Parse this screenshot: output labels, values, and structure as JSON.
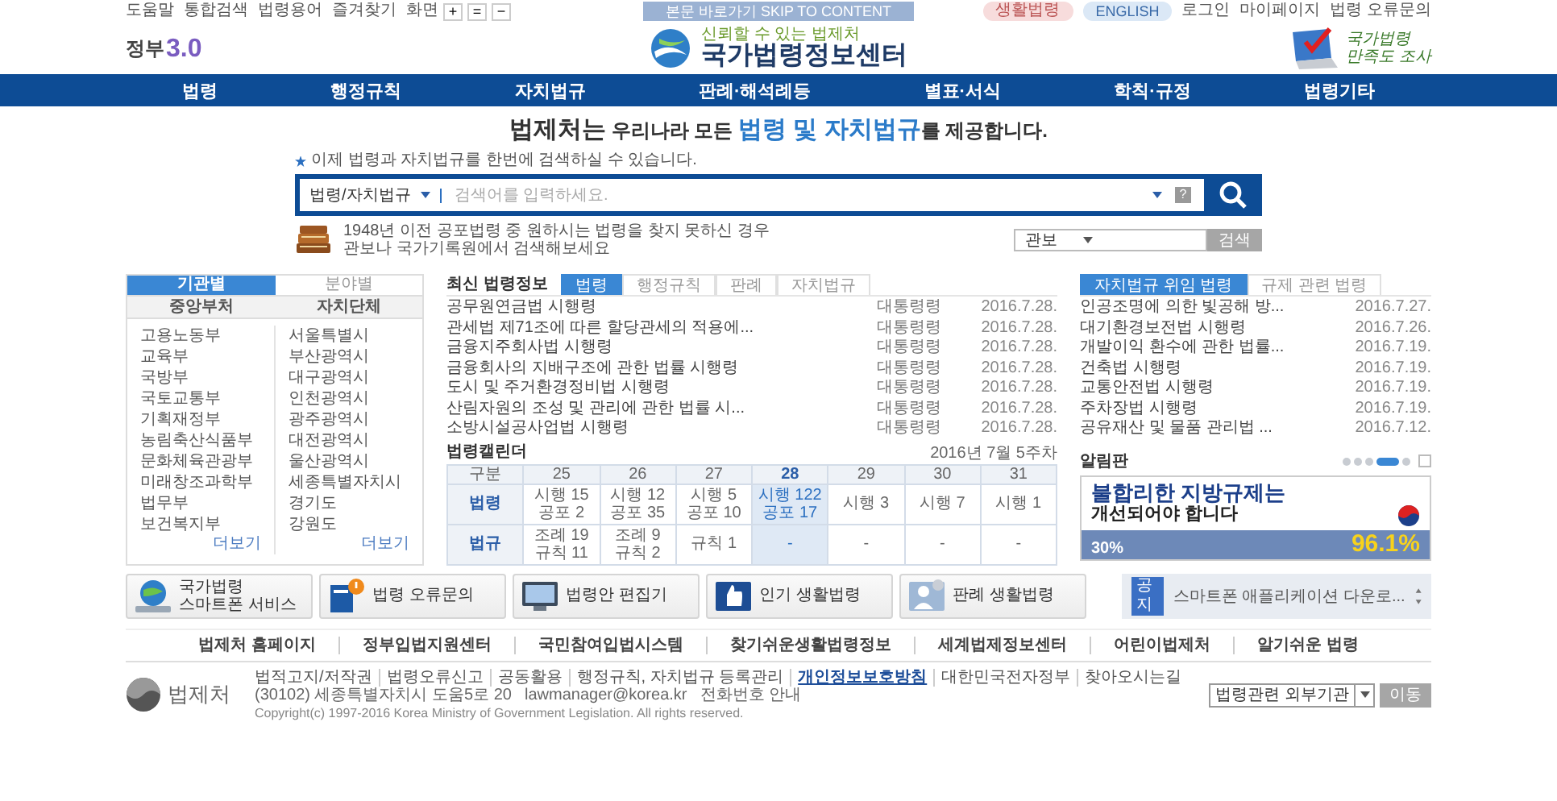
{
  "top_bar": {
    "links": [
      "도움말",
      "통합검색",
      "법령용어",
      "즐겨찾기"
    ],
    "zoom_label": "화면",
    "zoom_buttons": [
      "+",
      "=",
      "−"
    ],
    "skip_link": "본문 바로가기 SKIP TO CONTENT",
    "right_links": [
      {
        "label": "생활법령",
        "kind": "pink"
      },
      {
        "label": "ENGLISH",
        "kind": "blue"
      },
      {
        "label": "로그인",
        "kind": "plain"
      },
      {
        "label": "마이페이지",
        "kind": "plain"
      },
      {
        "label": "법령 오류문의",
        "kind": "plain"
      }
    ]
  },
  "header": {
    "gov_text": "정부",
    "gov_version": "3.0",
    "tagline": "신뢰할 수 있는 법제처",
    "title": "국가법령정보센터",
    "survey_lines": [
      "국가법령",
      "만족도 조사"
    ]
  },
  "nav": [
    "법령",
    "행정규칙",
    "자치법규",
    "판례·해석례등",
    "별표·서식",
    "학칙·규정",
    "법령기타"
  ],
  "headline": [
    {
      "text": "법제처는",
      "kind": "lead"
    },
    {
      "text": " 우리나라 모든 ",
      "kind": "plain"
    },
    {
      "text": "법령 및 자치법규",
      "kind": "key"
    },
    {
      "text": "를 제공합니다.",
      "kind": "plain"
    }
  ],
  "search": {
    "note": "이제 법령과 자치법규를 한번에 검색하실 수 있습니다.",
    "scope": "법령/자치법규",
    "placeholder": "검색어를 입력하세요.",
    "help": "?"
  },
  "archive": {
    "lines": [
      "1948년 이전 공포법령 중 원하시는 법령을 찾지 못하신 경우",
      "관보나 국가기록원에서 검색해보세요"
    ],
    "select": "관보",
    "button": "검색"
  },
  "org_panel": {
    "tabs": [
      {
        "label": "기관별",
        "selected": true
      },
      {
        "label": "분야별",
        "selected": false
      }
    ],
    "columns": [
      {
        "heading": "중앙부처",
        "items": [
          "고용노동부",
          "교육부",
          "국방부",
          "국토교통부",
          "기획재정부",
          "농림축산식품부",
          "문화체육관광부",
          "미래창조과학부",
          "법무부",
          "보건복지부"
        ],
        "more": "더보기"
      },
      {
        "heading": "자치단체",
        "items": [
          "서울특별시",
          "부산광역시",
          "대구광역시",
          "인천광역시",
          "광주광역시",
          "대전광역시",
          "울산광역시",
          "세종특별자치시",
          "경기도",
          "강원도"
        ],
        "more": "더보기"
      }
    ]
  },
  "latest": {
    "title": "최신 법령정보",
    "tabs": [
      {
        "label": "법령",
        "selected": true
      },
      {
        "label": "행정규칙",
        "selected": false
      },
      {
        "label": "판례",
        "selected": false
      },
      {
        "label": "자치법규",
        "selected": false
      }
    ],
    "rows": [
      {
        "title": "공무원연금법 시행령",
        "type": "대통령령",
        "date": "2016.7.28."
      },
      {
        "title": "관세법 제71조에 따른 할당관세의 적용에...",
        "type": "대통령령",
        "date": "2016.7.28."
      },
      {
        "title": "금융지주회사법 시행령",
        "type": "대통령령",
        "date": "2016.7.28."
      },
      {
        "title": "금융회사의 지배구조에 관한 법률 시행령",
        "type": "대통령령",
        "date": "2016.7.28."
      },
      {
        "title": "도시 및 주거환경정비법 시행령",
        "type": "대통령령",
        "date": "2016.7.28."
      },
      {
        "title": "산림자원의 조성 및 관리에 관한 법률 시...",
        "type": "대통령령",
        "date": "2016.7.28."
      },
      {
        "title": "소방시설공사업법 시행령",
        "type": "대통령령",
        "date": "2016.7.28."
      }
    ]
  },
  "calendar": {
    "title": "법령캘린더",
    "week": "2016년 7월 5주차",
    "corner": "구분",
    "columns": [
      {
        "label": "25",
        "selected": false
      },
      {
        "label": "26",
        "selected": false
      },
      {
        "label": "27",
        "selected": false
      },
      {
        "label": "28",
        "selected": true
      },
      {
        "label": "29",
        "selected": false
      },
      {
        "label": "30",
        "selected": false
      },
      {
        "label": "31",
        "selected": false
      }
    ],
    "rows": [
      {
        "label": "법령",
        "cells": [
          [
            "시행 15",
            "공포 2"
          ],
          [
            "시행 12",
            "공포 35"
          ],
          [
            "시행 5",
            "공포 10"
          ],
          [
            "시행 122",
            "공포 17"
          ],
          [
            "시행 3"
          ],
          [
            "시행 7"
          ],
          [
            "시행 1"
          ]
        ]
      },
      {
        "label": "법규",
        "cells": [
          [
            "조례 19",
            "규칙 11"
          ],
          [
            "조례 9",
            "규칙 2"
          ],
          [
            "규칙 1"
          ],
          [
            "-"
          ],
          [
            "-"
          ],
          [
            "-"
          ],
          [
            "-"
          ]
        ]
      }
    ]
  },
  "delegated": {
    "tabs": [
      {
        "label": "자치법규 위임 법령",
        "selected": true
      },
      {
        "label": "규제 관련 법령",
        "selected": false
      }
    ],
    "rows": [
      {
        "title": "인공조명에 의한 빛공해 방...",
        "date": "2016.7.27."
      },
      {
        "title": "대기환경보전법 시행령",
        "date": "2016.7.26."
      },
      {
        "title": "개발이익 환수에 관한 법률...",
        "date": "2016.7.19."
      },
      {
        "title": "건축법 시행령",
        "date": "2016.7.19."
      },
      {
        "title": "교통안전법 시행령",
        "date": "2016.7.19."
      },
      {
        "title": "주차장법 시행령",
        "date": "2016.7.19."
      },
      {
        "title": "공유재산 및 물품 관리법 ...",
        "date": "2016.7.12."
      }
    ]
  },
  "notice_board": {
    "title": "알림판",
    "pages": [
      {
        "selected": false
      },
      {
        "selected": false
      },
      {
        "selected": false
      },
      {
        "selected": true
      },
      {
        "selected": false
      }
    ],
    "banner": {
      "headline": "불합리한 지방규제는",
      "subline": "개선되어야 합니다",
      "small": "30%",
      "big": "96.1%"
    }
  },
  "quick_buttons": [
    {
      "label": "국가법령\n스마트폰 서비스",
      "kind": "globe"
    },
    {
      "label": "법령 오류문의",
      "kind": "alert"
    },
    {
      "label": "법령안 편집기",
      "kind": "monitor"
    },
    {
      "label": "인기 생활법령",
      "kind": "thumb"
    },
    {
      "label": "판례 생활법령",
      "kind": "person"
    }
  ],
  "notice": {
    "badge": "공지",
    "text": "스마트폰 애플리케이션 다운로..."
  },
  "related_sites": [
    "법제처 홈페이지",
    "정부입법지원센터",
    "국민참여입법시스템",
    "찾기쉬운생활법령정보",
    "세계법제정보센터",
    "어린이법제처",
    "알기쉬운 법령"
  ],
  "footer": {
    "logo": "법제처",
    "links": [
      {
        "label": "법적고지/저작권",
        "emphasis": false
      },
      {
        "label": "법령오류신고",
        "emphasis": false
      },
      {
        "label": "공동활용",
        "emphasis": false
      },
      {
        "label": "행정규칙, 자치법규 등록관리",
        "emphasis": false
      },
      {
        "label": "개인정보보호방침",
        "emphasis": true
      },
      {
        "label": "대한민국전자정부",
        "emphasis": false
      },
      {
        "label": "찾아오시는길",
        "emphasis": false
      }
    ],
    "address": "(30102) 세종특별자치시 도움5로 20",
    "email": "lawmanager@korea.kr",
    "phone": "전화번호 안내",
    "copyright": "Copyright(c) 1997-2016 Korea Ministry of Government Legislation. All rights reserved.",
    "site_select": "법령관련 외부기관",
    "go": "이동"
  }
}
